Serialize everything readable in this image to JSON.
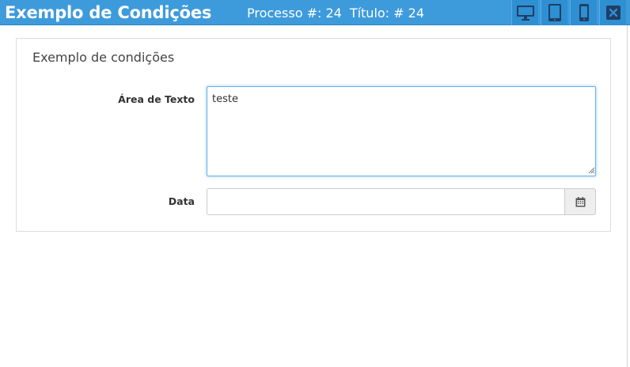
{
  "header": {
    "app_title": "Exemplo de Condições",
    "process_label": "Processo #: 24",
    "title_label": "Título: # 24",
    "buttons": [
      {
        "icon": "desktop-icon"
      },
      {
        "icon": "tablet-icon"
      },
      {
        "icon": "mobile-icon"
      },
      {
        "icon": "close-icon"
      }
    ]
  },
  "panel": {
    "title": "Exemplo de condições",
    "text_area": {
      "label": "Área de Texto",
      "value": "teste"
    },
    "date": {
      "label": "Data",
      "value": "",
      "button_icon": "calendar-icon"
    }
  },
  "colors": {
    "header_bg": "#3d9bdc",
    "header_button_bg": "#2e8fd3",
    "focus_border": "#66afe9"
  }
}
